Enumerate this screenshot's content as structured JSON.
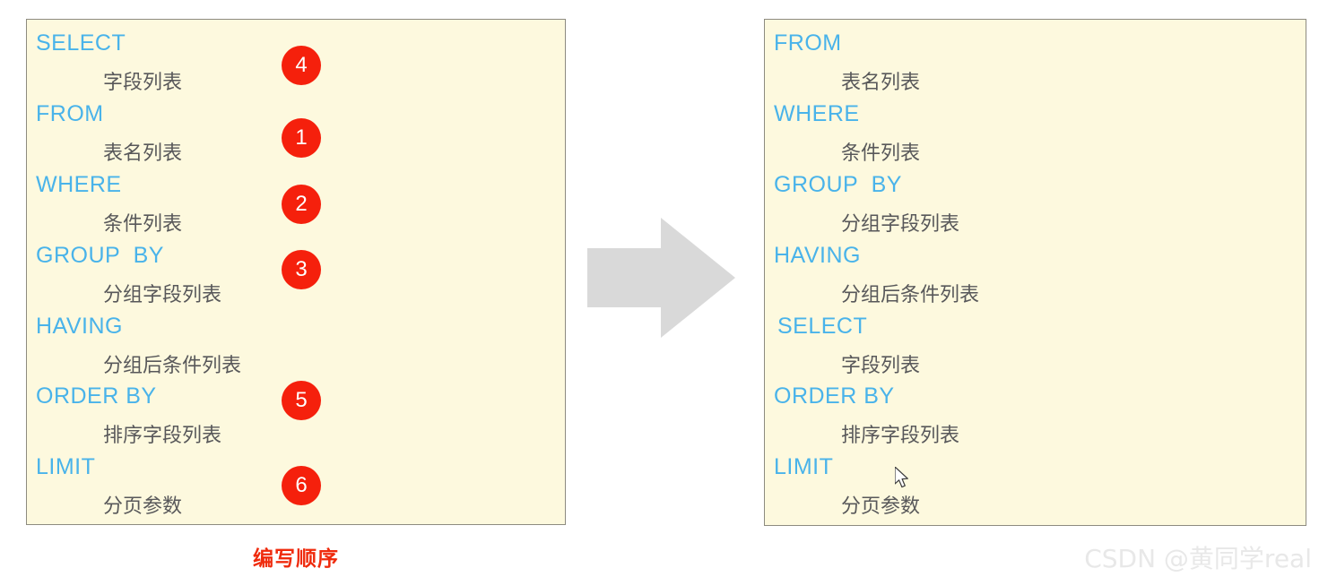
{
  "colors": {
    "panel_bg": "#fdf9de",
    "panel_border": "#8d8b80",
    "keyword": "#49b3ea",
    "value_text": "#58585a",
    "badge_bg": "#f5200c",
    "badge_text": "#ffffff",
    "caption": "#ef2b0d",
    "arrow": "#d9d9d9",
    "watermark": "#e8e8e8",
    "page_bg": "#ffffff"
  },
  "left_panel": {
    "title": "编写顺序",
    "clauses": [
      {
        "keyword": "SELECT",
        "value": "字段列表",
        "badge": "4"
      },
      {
        "keyword": "FROM",
        "value": "表名列表",
        "badge": "1"
      },
      {
        "keyword": "WHERE",
        "value": "条件列表",
        "badge": "2"
      },
      {
        "keyword": "GROUP  BY",
        "value": "分组字段列表",
        "badge": "3"
      },
      {
        "keyword": "HAVING",
        "value": "分组后条件列表",
        "badge": ""
      },
      {
        "keyword": "ORDER BY",
        "value": "排序字段列表",
        "badge": "5"
      },
      {
        "keyword": "LIMIT",
        "value": "分页参数",
        "badge": "6"
      }
    ]
  },
  "right_panel": {
    "clauses": [
      {
        "keyword": "FROM",
        "value": "表名列表"
      },
      {
        "keyword": "WHERE",
        "value": "条件列表"
      },
      {
        "keyword": "GROUP  BY",
        "value": "分组字段列表"
      },
      {
        "keyword": "HAVING",
        "value": "分组后条件列表"
      },
      {
        "keyword": "SELECT",
        "value": "字段列表"
      },
      {
        "keyword": "ORDER BY",
        "value": "排序字段列表"
      },
      {
        "keyword": "LIMIT",
        "value": "分页参数"
      }
    ]
  },
  "arrow": {
    "direction": "right",
    "name": "right-arrow-icon"
  },
  "watermark": {
    "text": "CSDN @黄同学real"
  }
}
